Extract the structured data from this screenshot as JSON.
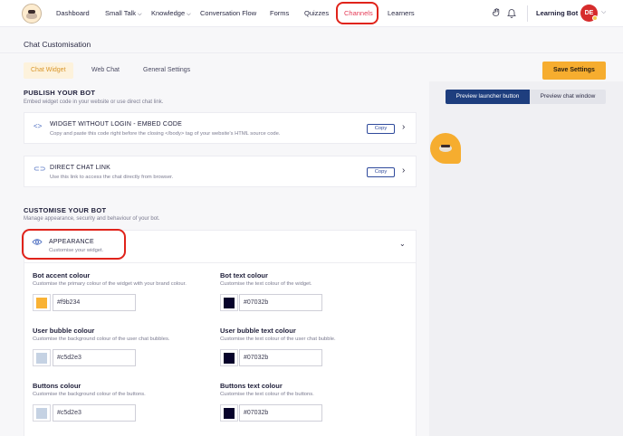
{
  "nav": {
    "items": [
      {
        "label": "Dashboard",
        "has_chevron": false
      },
      {
        "label": "Small Talk",
        "has_chevron": true
      },
      {
        "label": "Knowledge",
        "has_chevron": true
      },
      {
        "label": "Conversation Flow",
        "has_chevron": false
      },
      {
        "label": "Forms",
        "has_chevron": false
      },
      {
        "label": "Quizzes",
        "has_chevron": false
      },
      {
        "label": "Channels",
        "has_chevron": false,
        "active": true
      },
      {
        "label": "Learners",
        "has_chevron": false
      }
    ],
    "icons": [
      "hand-icon",
      "bell-icon"
    ],
    "user_name": "Learning Bot",
    "avatar_initials": "DE"
  },
  "page": {
    "title": "Chat Customisation",
    "tabs": [
      "Chat Widget",
      "Web Chat",
      "General Settings"
    ],
    "active_tab": "Chat Widget",
    "save_label": "Save Settings"
  },
  "publish": {
    "heading": "PUBLISH YOUR BOT",
    "subtitle": "Embed widget code in your website or use direct chat link.",
    "embed": {
      "title": "WIDGET WITHOUT LOGIN - EMBED CODE",
      "desc": "Copy and paste this code right before the closing </body> tag of your website's HTML source code.",
      "copy_label": "Copy"
    },
    "link": {
      "title": "DIRECT CHAT LINK",
      "desc": "Use this link to access the chat directly from browser.",
      "copy_label": "Copy"
    }
  },
  "customise": {
    "heading": "CUSTOMISE YOUR BOT",
    "subtitle": "Manage appearance, security and behaviour of your bot.",
    "appearance_title": "APPEARANCE",
    "appearance_desc": "Customise your widget."
  },
  "colors": {
    "bot_accent": {
      "label": "Bot accent colour",
      "desc": "Customise the primary colour of the widget with your brand colour.",
      "value": "#f9b234"
    },
    "bot_text": {
      "label": "Bot text colour",
      "desc": "Customise the text colour of the widget.",
      "value": "#07032b"
    },
    "user_bubble": {
      "label": "User bubble colour",
      "desc": "Customise the background colour of the user chat bubbles.",
      "value": "#c5d2e3"
    },
    "user_bubble_text": {
      "label": "User bubble text colour",
      "desc": "Customise the text colour of the user chat bubble.",
      "value": "#07032b"
    },
    "buttons": {
      "label": "Buttons colour",
      "desc": "Customise the background colour of the buttons.",
      "value": "#c5d2e3"
    },
    "buttons_text": {
      "label": "Buttons text colour",
      "desc": "Customise the text colour of the buttons.",
      "value": "#07032b"
    }
  },
  "preview": {
    "launcher_label": "Preview launcher button",
    "window_label": "Preview chat window",
    "active": "Preview launcher button"
  },
  "theme": {
    "accent": "#f6ad2f",
    "navy": "#1e3e7e",
    "highlight_ring": "#e0231a"
  }
}
